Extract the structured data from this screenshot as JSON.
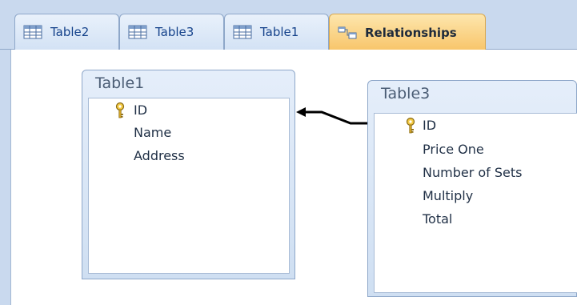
{
  "tabs": [
    {
      "label": "Table2",
      "icon": "table-icon"
    },
    {
      "label": "Table3",
      "icon": "table-icon"
    },
    {
      "label": "Table1",
      "icon": "table-icon"
    },
    {
      "label": "Relationships",
      "icon": "relationships-icon",
      "active": true
    }
  ],
  "tables": [
    {
      "title": "Table1",
      "key_field": "ID",
      "fields": [
        "Name",
        "Address"
      ]
    },
    {
      "title": "Table3",
      "key_field": "ID",
      "fields": [
        "Price One",
        "Number of Sets",
        "Multiply",
        "Total"
      ]
    }
  ],
  "colors": {
    "tab_bar": "#c9d9ee",
    "active_tab": "#f8c56a",
    "tab_text": "#15428b",
    "table_header": "#d6e3f4",
    "relationship_line": "#000000"
  }
}
